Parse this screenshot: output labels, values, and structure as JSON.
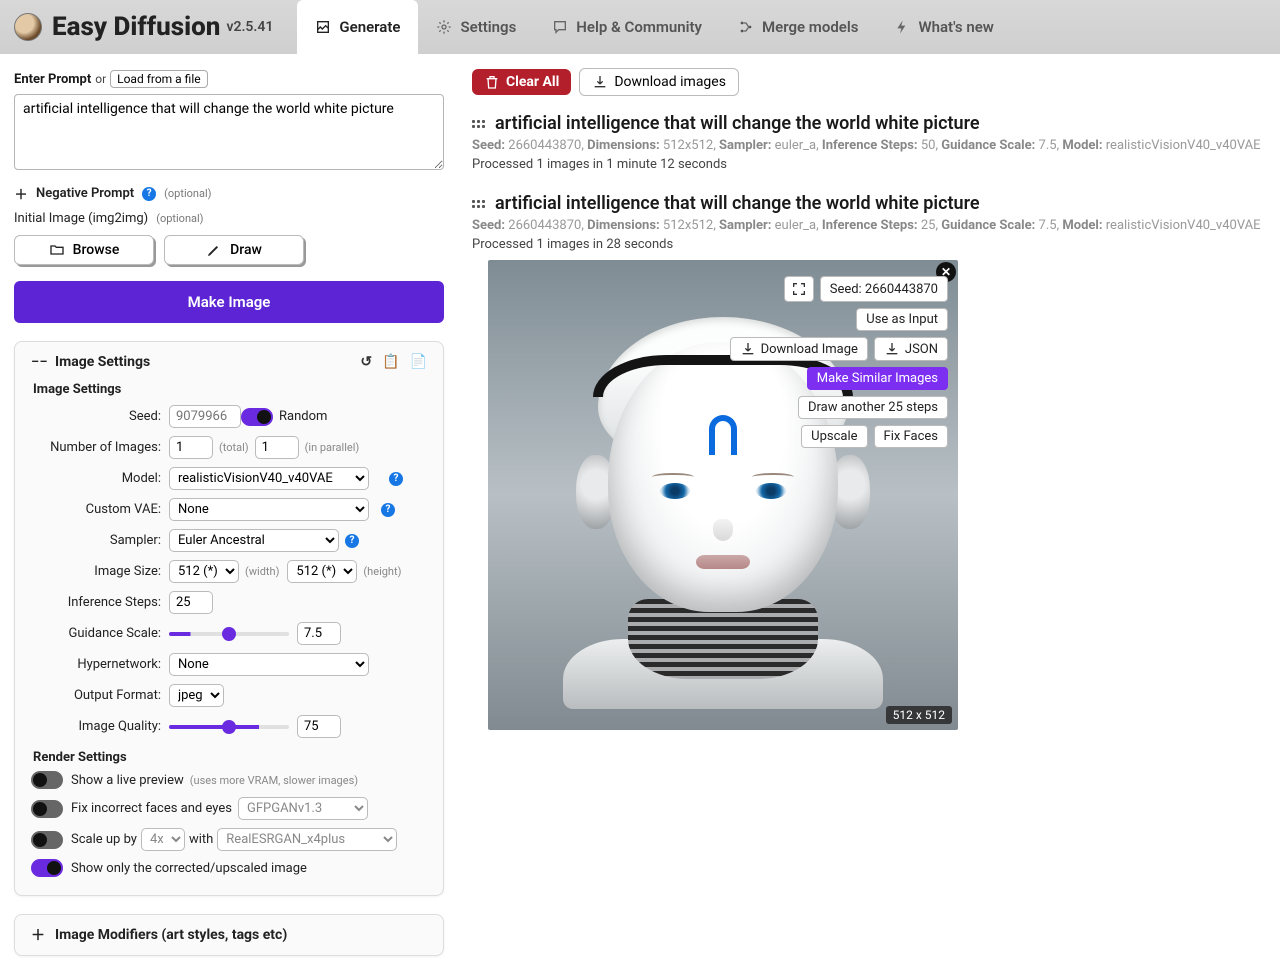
{
  "app": {
    "title": "Easy Diffusion",
    "version": "v2.5.41"
  },
  "tabs": {
    "generate": "Generate",
    "settings": "Settings",
    "help": "Help & Community",
    "merge": "Merge models",
    "whatsnew": "What's new"
  },
  "prompt": {
    "label": "Enter Prompt",
    "or": "or",
    "loadfile": "Load from a file",
    "value": "artificial intelligence that will change the world white picture",
    "negative_label": "Negative Prompt",
    "optional": "(optional)",
    "initial_label": "Initial Image (img2img)",
    "browse": "Browse",
    "draw": "Draw",
    "make": "Make Image"
  },
  "panel": {
    "title": "Image Settings",
    "sub_image": "Image Settings",
    "seed_label": "Seed:",
    "seed_placeholder": "9079966",
    "random": "Random",
    "num_images_label": "Number of Images:",
    "num_total": "1",
    "num_parallel": "1",
    "hint_total": "(total)",
    "hint_parallel": "(in parallel)",
    "model_label": "Model:",
    "model_value": "realisticVisionV40_v40VAE",
    "vae_label": "Custom VAE:",
    "vae_value": "None",
    "sampler_label": "Sampler:",
    "sampler_value": "Euler Ancestral",
    "size_label": "Image Size:",
    "size_w": "512 (*)",
    "size_h": "512 (*)",
    "hint_w": "(width)",
    "hint_h": "(height)",
    "steps_label": "Inference Steps:",
    "steps_value": "25",
    "gs_label": "Guidance Scale:",
    "gs_value": "7.5",
    "hyper_label": "Hypernetwork:",
    "hyper_value": "None",
    "fmt_label": "Output Format:",
    "fmt_value": "jpeg",
    "quality_label": "Image Quality:",
    "quality_value": "75",
    "render_hdr": "Render Settings",
    "live_preview": "Show a live preview",
    "live_hint": "(uses more VRAM, slower images)",
    "fixfaces": "Fix incorrect faces and eyes",
    "fixfaces_model": "GFPGANv1.3",
    "scaleup": "Scale up by",
    "scaleby": "4x",
    "with": "with",
    "upscaler": "RealESRGAN_x4plus",
    "showcorrected": "Show only the corrected/upscaled image"
  },
  "modifiers": {
    "title": "Image Modifiers (art styles, tags etc)"
  },
  "actions": {
    "clear": "Clear All",
    "download": "Download images"
  },
  "results": [
    {
      "title": "artificial intelligence that will change the world white picture",
      "seed": "2660443870",
      "dims": "512x512",
      "sampler": "euler_a",
      "steps": "50",
      "gs": "7.5",
      "model": "realisticVisionV40_v40VAE",
      "processed": "Processed 1 images in 1 minute 12 seconds"
    },
    {
      "title": "artificial intelligence that will change the world white picture",
      "seed": "2660443870",
      "dims": "512x512",
      "sampler": "euler_a",
      "steps": "25",
      "gs": "7.5",
      "model": "realisticVisionV40_v40VAE",
      "processed": "Processed 1 images in 28 seconds"
    }
  ],
  "meta_labels": {
    "seed": "Seed:",
    "dims": "Dimensions:",
    "sampler": "Sampler:",
    "steps": "Inference Steps:",
    "gs": "Guidance Scale:",
    "model": "Model:"
  },
  "hover": {
    "seed": "Seed: 2660443870",
    "useinput": "Use as Input",
    "dl": "Download Image",
    "json": "JSON",
    "similar": "Make Similar Images",
    "again": "Draw another 25 steps",
    "upscale": "Upscale",
    "fix": "Fix Faces",
    "imgsize": "512 x 512"
  }
}
